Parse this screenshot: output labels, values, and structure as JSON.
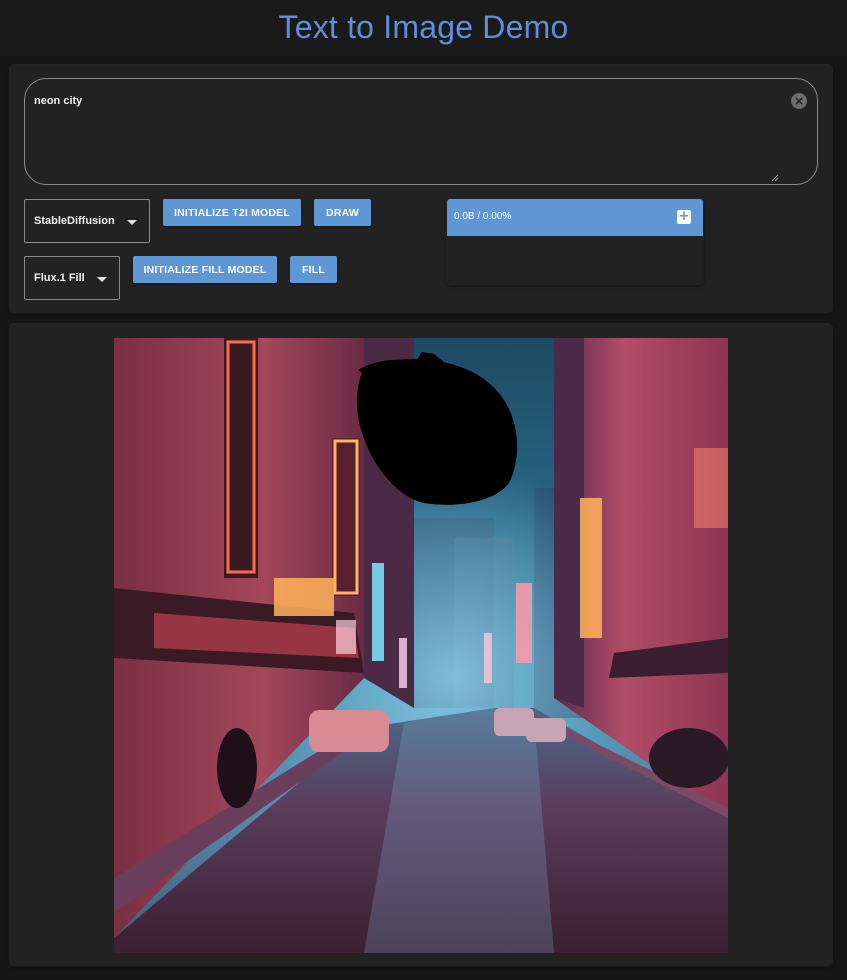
{
  "app": {
    "title": "Text to Image Demo"
  },
  "prompt": {
    "value": "neon city",
    "clear_icon": "close-circle-icon"
  },
  "t2i": {
    "model_select": "StableDiffusion",
    "init_button": "Initialize T2I Model",
    "draw_button": "Draw"
  },
  "fill": {
    "model_select": "Flux.1 Fill",
    "init_button": "Initialize Fill Model",
    "fill_button": "Fill"
  },
  "progress": {
    "text": "0.0B / 0.00%",
    "expand_icon": "plus-icon"
  },
  "output": {
    "image_icon": "generated-image"
  },
  "colors": {
    "accent": "#5f96d4",
    "title": "#5f8fd8",
    "background": "#171717",
    "card": "#222222"
  }
}
